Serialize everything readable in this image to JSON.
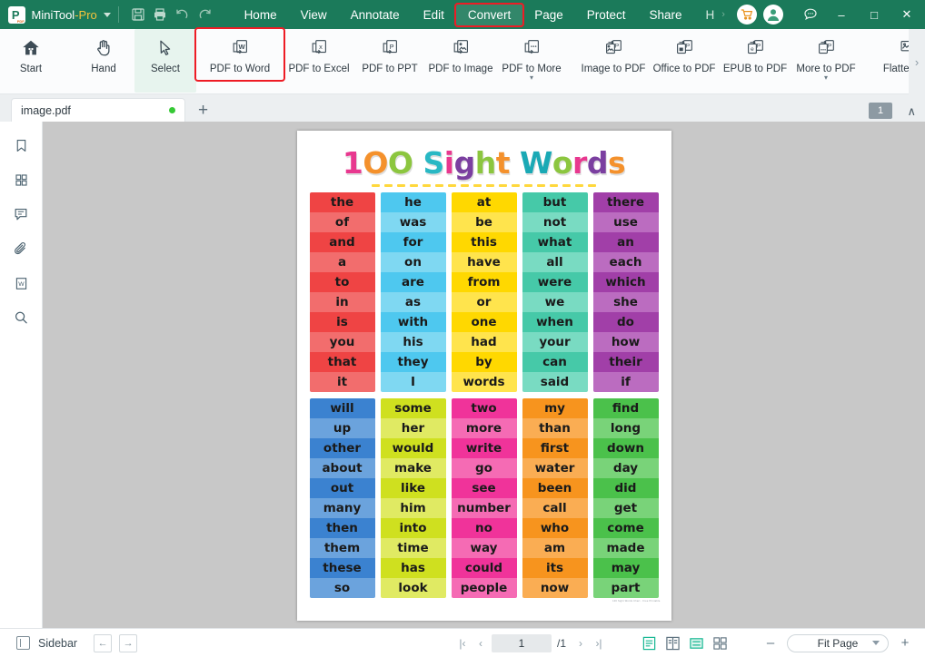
{
  "titlebar": {
    "brand_main": "MiniTool",
    "brand_suffix": "-Pro",
    "icons": {
      "save": "save-icon",
      "print": "print-icon",
      "undo": "undo-icon",
      "redo": "redo-icon"
    },
    "menu": [
      {
        "label": "Home",
        "active": false
      },
      {
        "label": "View",
        "active": false
      },
      {
        "label": "Annotate",
        "active": false
      },
      {
        "label": "Edit",
        "active": false
      },
      {
        "label": "Convert",
        "active": true
      },
      {
        "label": "Page",
        "active": false
      },
      {
        "label": "Protect",
        "active": false
      },
      {
        "label": "Share",
        "active": false
      },
      {
        "label": "H",
        "active": false
      }
    ],
    "overflow_chevron": "›",
    "cart_icon": "cart-icon",
    "account_icon": "account-icon",
    "feedback_icon": "chat-icon",
    "minimize": "–",
    "maximize": "□",
    "close": "✕",
    "highlight_color": "#ee1c25",
    "bar_color": "#1b7a5a"
  },
  "ribbon": {
    "items": [
      {
        "label": "Start",
        "icon": "home-icon",
        "state": "normal"
      },
      {
        "label": "Hand",
        "icon": "hand-icon",
        "state": "normal"
      },
      {
        "label": "Select",
        "icon": "cursor-icon",
        "state": "selected"
      },
      {
        "label": "PDF to Word",
        "icon": "pdf-to-word-icon",
        "state": "highlighted"
      },
      {
        "label": "PDF to Excel",
        "icon": "pdf-to-excel-icon",
        "state": "normal"
      },
      {
        "label": "PDF to PPT",
        "icon": "pdf-to-ppt-icon",
        "state": "normal"
      },
      {
        "label": "PDF to Image",
        "icon": "pdf-to-image-icon",
        "state": "normal"
      },
      {
        "label": "PDF to More",
        "icon": "pdf-to-more-icon",
        "state": "dropdown"
      },
      {
        "label": "Image to PDF",
        "icon": "image-to-pdf-icon",
        "state": "normal"
      },
      {
        "label": "Office to PDF",
        "icon": "office-to-pdf-icon",
        "state": "normal"
      },
      {
        "label": "EPUB to PDF",
        "icon": "epub-to-pdf-icon",
        "state": "normal"
      },
      {
        "label": "More to PDF",
        "icon": "more-to-pdf-icon",
        "state": "dropdown"
      },
      {
        "label": "Flatten PD",
        "icon": "flatten-pdf-icon",
        "state": "normal"
      }
    ],
    "scroll_right": "›"
  },
  "tabstrip": {
    "file_tab": "image.pdf",
    "modified_dot_color": "#36c935",
    "new_tab": "+",
    "page_badge": "1",
    "collapse": "∧"
  },
  "sidebar": {
    "icons": [
      {
        "name": "bookmark-icon"
      },
      {
        "name": "thumbnails-icon"
      },
      {
        "name": "comment-icon"
      },
      {
        "name": "attachment-icon"
      },
      {
        "name": "signature-word-icon"
      },
      {
        "name": "search-icon"
      }
    ]
  },
  "document": {
    "title_chars": [
      {
        "ch": "1",
        "color": "#e8388f"
      },
      {
        "ch": "O",
        "color": "#f4912c"
      },
      {
        "ch": "O",
        "color": "#8cc63f"
      },
      {
        "ch": " ",
        "color": "#ffffff"
      },
      {
        "ch": "S",
        "color": "#29b8c4"
      },
      {
        "ch": "i",
        "color": "#e8388f"
      },
      {
        "ch": "g",
        "color": "#7b3fa0"
      },
      {
        "ch": "h",
        "color": "#8cc63f"
      },
      {
        "ch": "t",
        "color": "#f4912c"
      },
      {
        "ch": " ",
        "color": "#ffffff"
      },
      {
        "ch": "W",
        "color": "#1aa9b5"
      },
      {
        "ch": "o",
        "color": "#8cc63f"
      },
      {
        "ch": "r",
        "color": "#e8388f"
      },
      {
        "ch": "d",
        "color": "#7b3fa0"
      },
      {
        "ch": "s",
        "color": "#f4912c"
      }
    ],
    "title_text": "100 Sight Words",
    "dash_count": 18,
    "dash_color": "#ffd83d",
    "credit": "100 Sight Words Chart · Free Printable",
    "columns": [
      {
        "id": "col-red",
        "base": "#ef4444",
        "alt": "#f26d6d",
        "words": [
          "the",
          "of",
          "and",
          "a",
          "to",
          "in",
          "is",
          "you",
          "that",
          "it"
        ]
      },
      {
        "id": "col-blue",
        "base": "#4ec8ef",
        "alt": "#7fd8f2",
        "words": [
          "he",
          "was",
          "for",
          "on",
          "are",
          "as",
          "with",
          "his",
          "they",
          "I"
        ]
      },
      {
        "id": "col-yellow",
        "base": "#ffd800",
        "alt": "#ffe44d",
        "words": [
          "at",
          "be",
          "this",
          "have",
          "from",
          "or",
          "one",
          "had",
          "by",
          "words"
        ]
      },
      {
        "id": "col-teal",
        "base": "#46c9a8",
        "alt": "#79dbc2",
        "words": [
          "but",
          "not",
          "what",
          "all",
          "were",
          "we",
          "when",
          "your",
          "can",
          "said"
        ]
      },
      {
        "id": "col-purple",
        "base": "#a13fa8",
        "alt": "#bb6cc0",
        "words": [
          "there",
          "use",
          "an",
          "each",
          "which",
          "she",
          "do",
          "how",
          "their",
          "if"
        ]
      },
      {
        "id": "col-darkblue",
        "base": "#3b82d0",
        "alt": "#6ba3dd",
        "words": [
          "will",
          "up",
          "other",
          "about",
          "out",
          "many",
          "then",
          "them",
          "these",
          "so"
        ]
      },
      {
        "id": "col-lime",
        "base": "#cfe01f",
        "alt": "#e0ea63",
        "words": [
          "some",
          "her",
          "would",
          "make",
          "like",
          "him",
          "into",
          "time",
          "has",
          "look"
        ]
      },
      {
        "id": "col-pink",
        "base": "#f0339a",
        "alt": "#f56bb4",
        "words": [
          "two",
          "more",
          "write",
          "go",
          "see",
          "number",
          "no",
          "way",
          "could",
          "people"
        ]
      },
      {
        "id": "col-orange",
        "base": "#f7941e",
        "alt": "#faad53",
        "words": [
          "my",
          "than",
          "first",
          "water",
          "been",
          "call",
          "who",
          "am",
          "its",
          "now"
        ]
      },
      {
        "id": "col-green",
        "base": "#4bc14b",
        "alt": "#79d379",
        "words": [
          "find",
          "long",
          "down",
          "day",
          "did",
          "get",
          "come",
          "made",
          "may",
          "part"
        ]
      }
    ]
  },
  "status": {
    "sidebar_label": "Sidebar",
    "prev_arrow": "←",
    "next_arrow": "→",
    "first_page": "|‹",
    "page_back": "‹",
    "current_page": "1",
    "total_pages": "/1",
    "page_fwd": "›",
    "last_page": "›|",
    "view_modes": [
      {
        "name": "single-page-view",
        "active": true
      },
      {
        "name": "two-page-view",
        "active": false
      },
      {
        "name": "continuous-view",
        "active": true
      },
      {
        "name": "grid-view",
        "active": false
      }
    ],
    "zoom_out": "–",
    "zoom_level": "Fit Page",
    "zoom_in": "+",
    "active_color": "#18b894"
  }
}
